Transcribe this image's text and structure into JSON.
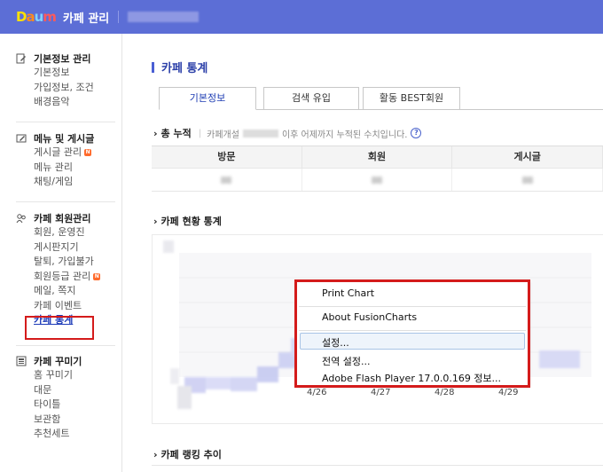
{
  "header": {
    "logo_text": "Daum",
    "title": "카페 관리",
    "brand_color": "#5c6ed6"
  },
  "sidebar": {
    "groups": [
      {
        "title": "기본정보 관리",
        "icon": "edit-icon",
        "items": [
          "기본정보",
          "가입정보, 조건",
          "배경음악"
        ]
      },
      {
        "title": "메뉴 및 게시글",
        "icon": "board-icon",
        "items": [
          "게시글 관리",
          "메뉴 관리",
          "채팅/게임"
        ]
      },
      {
        "title": "카페 회원관리",
        "icon": "members-icon",
        "items": [
          "회원, 운영진",
          "게시판지기",
          "탈퇴, 가입불가",
          "회원등급 관리",
          "메일, 쪽지",
          "카페 이벤트",
          "카페 통계"
        ]
      },
      {
        "title": "카페 꾸미기",
        "icon": "decorate-icon",
        "items": [
          "홈 꾸미기",
          "대문",
          "타이틀",
          "보관함",
          "추천세트"
        ]
      }
    ],
    "new_badge": "N",
    "active_item": "카페 통계"
  },
  "main": {
    "page_title": "카페 통계",
    "tabs": [
      {
        "label": "기본정보",
        "active": true
      },
      {
        "label": "검색 유입",
        "active": false
      },
      {
        "label": "활동 BEST회원",
        "active": false
      }
    ],
    "total": {
      "title": "총 누적",
      "sub_prefix": "카페개설",
      "sub_suffix": "이후 어제까지 누적된 수치입니다.",
      "help": "?",
      "columns": [
        "방문",
        "회원",
        "게시글"
      ]
    },
    "status_section": {
      "title": "카페 현황 통계"
    },
    "ranking_section": {
      "title": "카페 랭킹 추이"
    },
    "chart_data": {
      "type": "line",
      "categories": [
        "4/26",
        "4/27",
        "4/28",
        "4/29"
      ],
      "title": "",
      "xlabel": "",
      "ylabel": ""
    },
    "context_menu": {
      "items": [
        "Print Chart",
        "About FusionCharts",
        "설정...",
        "전역 설정...",
        "Adobe Flash Player 17.0.0.169 정보..."
      ],
      "highlighted": "설정..."
    }
  },
  "colors": {
    "accent": "#2b3fa8",
    "highlight_box": "#d41b1b",
    "new_badge": "#ff6a2b"
  }
}
